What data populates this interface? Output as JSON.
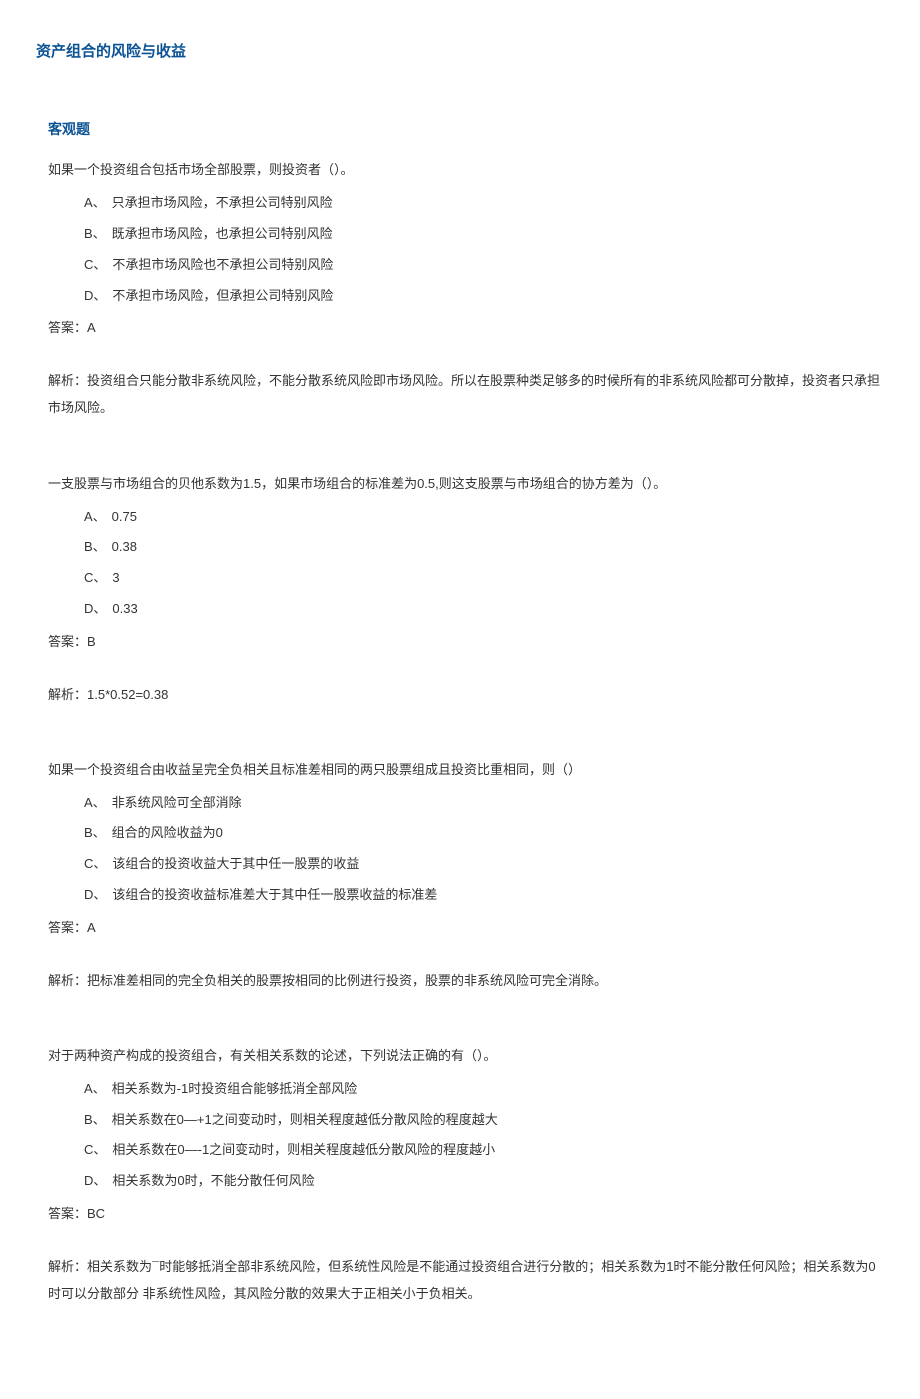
{
  "title": "资产组合的风险与收益",
  "section": "客观题",
  "questions": [
    {
      "stem": "如果一个投资组合包括市场全部股票，则投资者（）。",
      "options": {
        "A": "只承担市场风险，不承担公司特别风险",
        "B": "既承担市场风险，也承担公司特别风险",
        "C": "不承担市场风险也不承担公司特别风险",
        "D": "不承担市场风险，但承担公司特别风险"
      },
      "answer_label": "答案：",
      "answer": "A",
      "analysis_label": "解析：",
      "analysis": "投资组合只能分散非系统风险，不能分散系统风险即市场风险。所以在股票种类足够多的时候所有的非系统风险都可分散掉，投资者只承担市场风险。"
    },
    {
      "stem": "一支股票与市场组合的贝他系数为1.5，如果市场组合的标准差为0.5,则这支股票与市场组合的协方差为（）。",
      "options": {
        "A": "0.75",
        "B": "0.38",
        "C": "3",
        "D": "0.33"
      },
      "answer_label": "答案：",
      "answer": "B",
      "analysis_label": "解析：",
      "analysis": "1.5*0.52=0.38"
    },
    {
      "stem": "如果一个投资组合由收益呈完全负相关且标准差相同的两只股票组成且投资比重相同，则（）",
      "options": {
        "A": "非系统风险可全部消除",
        "B": "组合的风险收益为0",
        "C": "该组合的投资收益大于其中任一股票的收益",
        "D": "该组合的投资收益标准差大于其中任一股票收益的标准差"
      },
      "answer_label": "答案：",
      "answer": "A",
      "analysis_label": "解析：",
      "analysis": "把标准差相同的完全负相关的股票按相同的比例进行投资，股票的非系统风险可完全消除。"
    },
    {
      "stem": "对于两种资产构成的投资组合，有关相关系数的论述，下列说法正确的有（）。",
      "options": {
        "A": "相关系数为-1时投资组合能够抵消全部风险",
        "B": "相关系数在0—+1之间变动时，则相关程度越低分散风险的程度越大",
        "C": "相关系数在0—-1之间变动时，则相关程度越低分散风险的程度越小",
        "D": "相关系数为0时，不能分散任何风险"
      },
      "answer_label": "答案：",
      "answer": "BC",
      "analysis_label": "解析：",
      "analysis": "相关系数为¯时能够抵消全部非系统风险，但系统性风险是不能通过投资组合进行分散的；相关系数为1时不能分散任何风险；相关系数为0时可以分散部分 非系统性风险，其风险分散的效果大于正相关小于负相关。"
    }
  ]
}
